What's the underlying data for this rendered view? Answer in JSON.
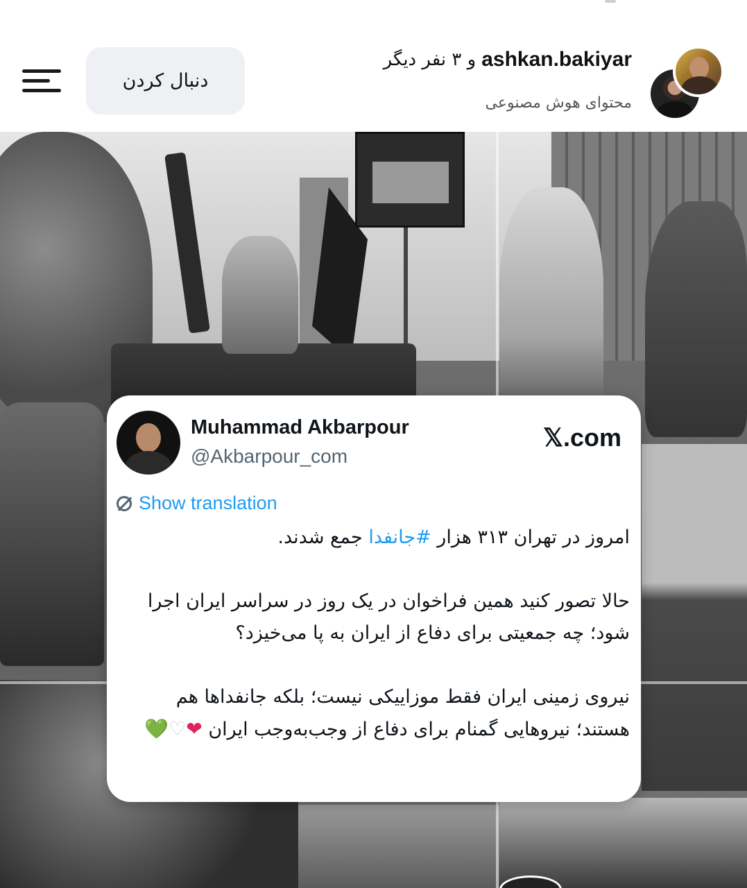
{
  "header": {
    "username": "ashkan.bakiyar",
    "others_label": "و ۳ نفر دیگر",
    "subtitle": "محتوای هوش مصنوعی",
    "follow_label": "دنبال کردن"
  },
  "tweet": {
    "display_name": "Muhammad Akbarpour",
    "handle": "@Akbarpour_com",
    "brand": "𝕏.com",
    "translate_label": "Show translation",
    "line1_before": "امروز در تهران ۳۱۳ هزار ",
    "hashtag": "#جانفدا",
    "line1_after": " جمع شدند.",
    "paragraph2": "حالا تصور کنید همین فراخوان در یک روز در سراسر ایران اجرا شود؛ چه جمعیتی برای دفاع از ایران به پا می‌خیزد؟",
    "paragraph3": "نیروی زمینی ایران فقط موزاییکی نیست؛ بلکه جانفداها هم هستند؛ نیروهایی گمنام برای دفاع از وجب‌به‌وجب ایران",
    "emojis": [
      "❤",
      "♡",
      "💚"
    ]
  },
  "icons": {
    "menu": "hamburger-menu-icon",
    "translate": "translate-icon"
  },
  "colors": {
    "link": "#1d9bf0",
    "handle": "#536471",
    "follow_bg": "#eef0f3"
  }
}
